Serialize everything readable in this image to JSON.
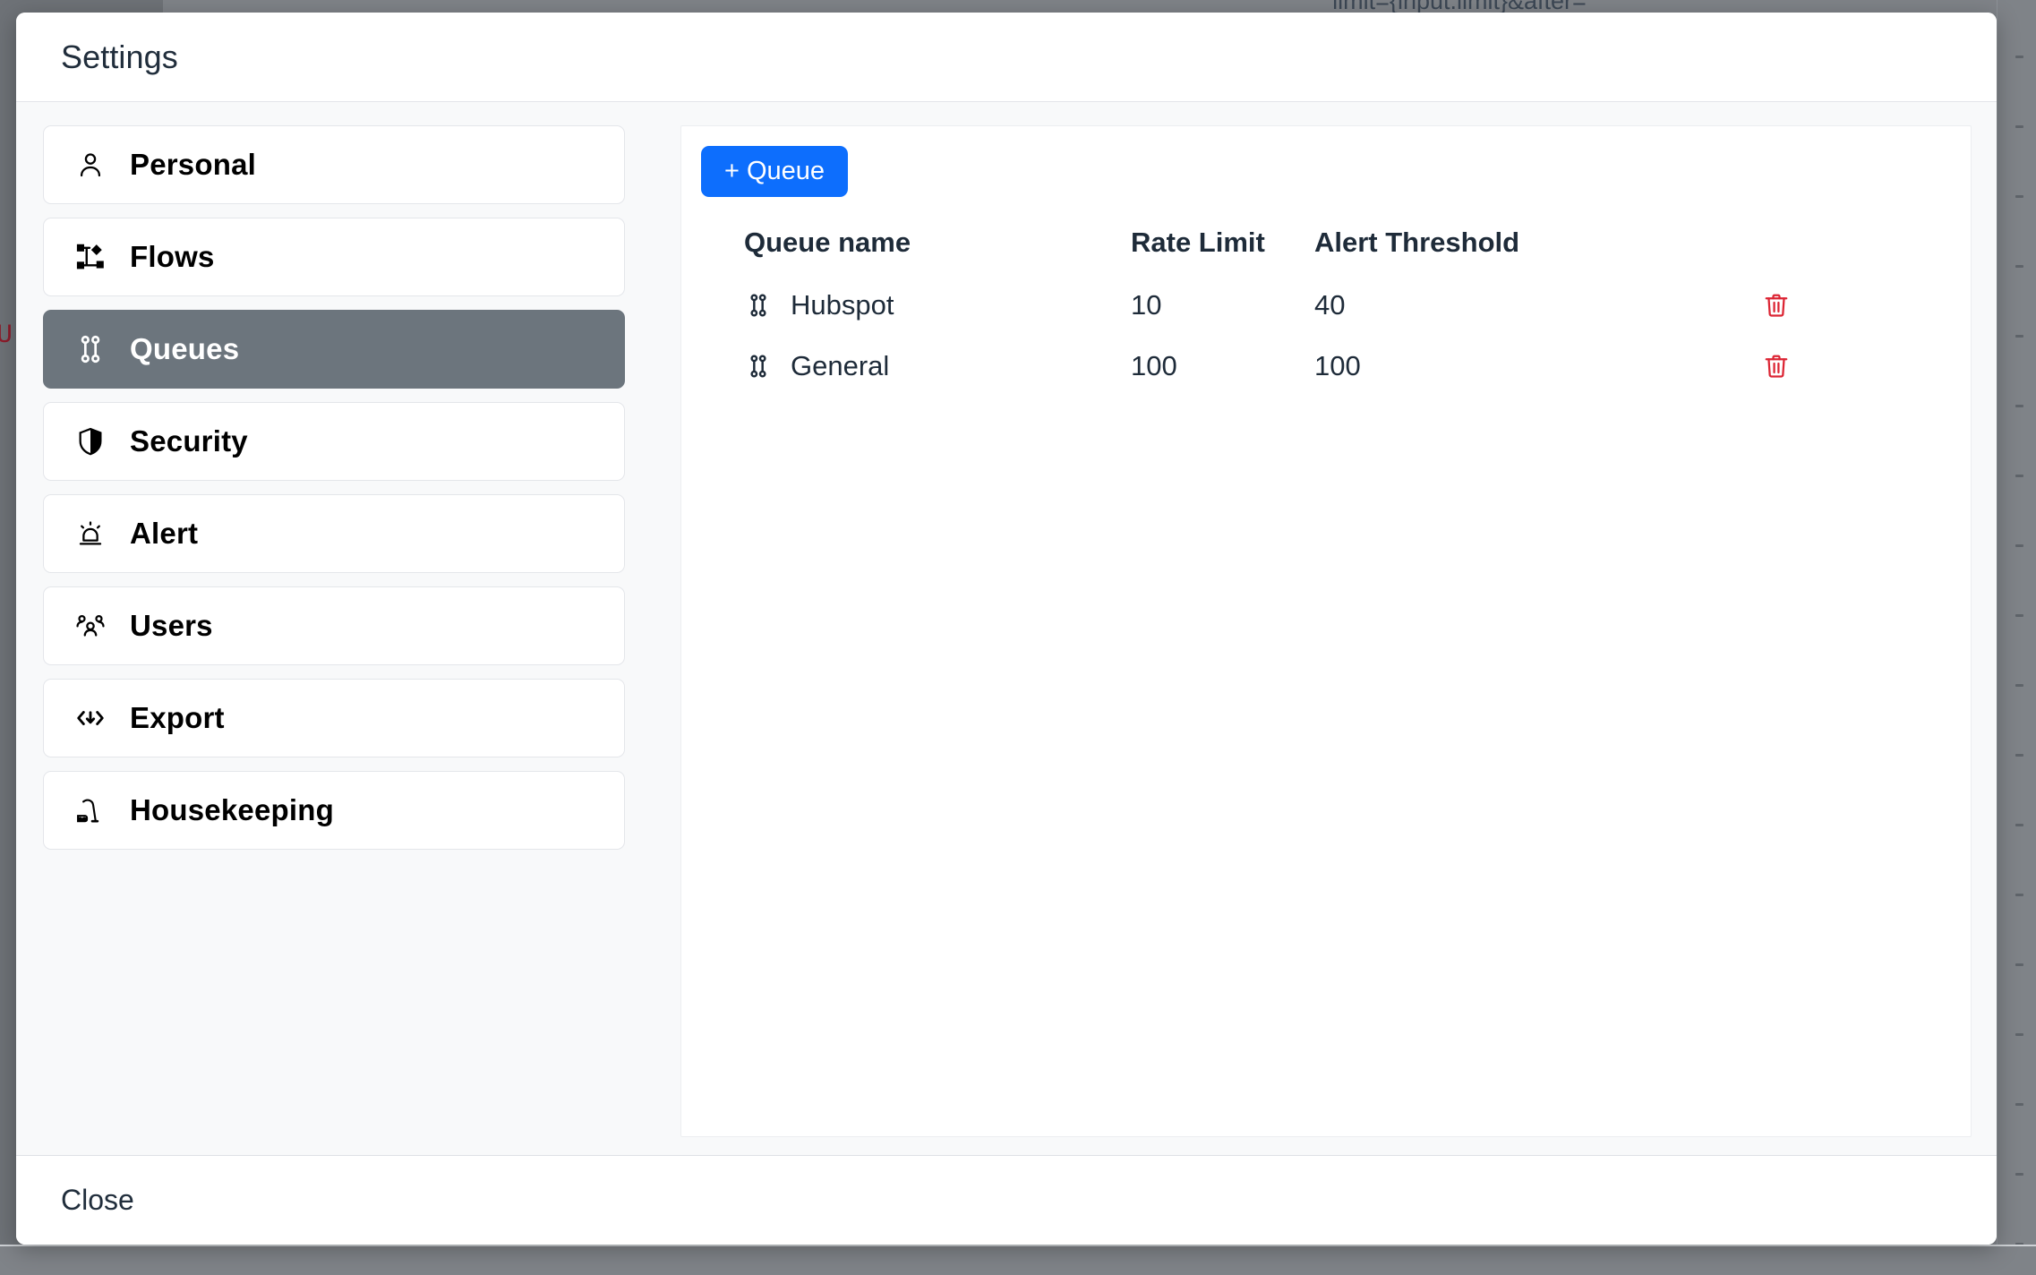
{
  "backdrop": {
    "code_text": "limit={input.limit}&after=",
    "red_char": "U"
  },
  "modal": {
    "title": "Settings",
    "close_label": "Close"
  },
  "sidebar": {
    "items": [
      {
        "label": "Personal",
        "icon": "person-icon",
        "active": false
      },
      {
        "label": "Flows",
        "icon": "flow-nodes-icon",
        "active": false
      },
      {
        "label": "Queues",
        "icon": "queue-icon",
        "active": true
      },
      {
        "label": "Security",
        "icon": "shield-icon",
        "active": false
      },
      {
        "label": "Alert",
        "icon": "siren-icon",
        "active": false
      },
      {
        "label": "Users",
        "icon": "users-group-icon",
        "active": false
      },
      {
        "label": "Export",
        "icon": "code-download-icon",
        "active": false
      },
      {
        "label": "Housekeeping",
        "icon": "vacuum-icon",
        "active": false
      }
    ]
  },
  "content": {
    "add_queue_label": "+ Queue",
    "accent_color": "#0d6efd",
    "delete_color": "#dc2534",
    "active_item_color": "#6c757d",
    "table": {
      "columns": [
        "Queue name",
        "Rate Limit",
        "Alert Threshold",
        ""
      ],
      "rows": [
        {
          "icon": "queue-icon",
          "name": "Hubspot",
          "rate_limit": "10",
          "alert_threshold": "40",
          "delete_icon": "trash-icon"
        },
        {
          "icon": "queue-icon",
          "name": "General",
          "rate_limit": "100",
          "alert_threshold": "100",
          "delete_icon": "trash-icon"
        }
      ]
    }
  }
}
